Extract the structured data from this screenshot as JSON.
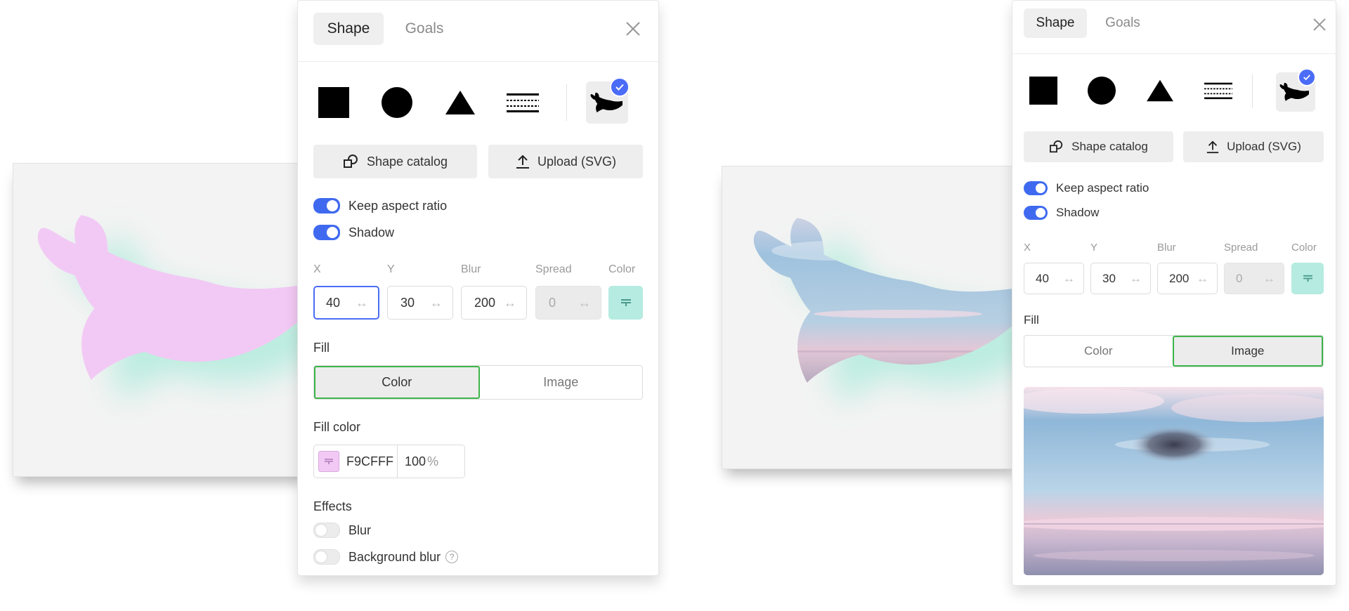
{
  "colors": {
    "accent": "#3f6af0",
    "active_segment_border": "#3cb54a",
    "shadow_color": "#b5ebe0",
    "fill_color": "#F9CFFF"
  },
  "left_panel": {
    "tabs": [
      {
        "label": "Shape",
        "active": true
      },
      {
        "label": "Goals",
        "active": false
      }
    ],
    "shapes": [
      "square-icon",
      "circle-icon",
      "triangle-icon",
      "dashed-lines-icon",
      "whale-icon"
    ],
    "selected_shape": "whale-icon",
    "buttons": {
      "catalog": "Shape catalog",
      "upload": "Upload (SVG)"
    },
    "toggles": {
      "keep_aspect": {
        "label": "Keep aspect ratio",
        "on": true
      },
      "shadow": {
        "label": "Shadow",
        "on": true
      }
    },
    "shadow_fields": {
      "x": {
        "label": "X",
        "value": "40"
      },
      "y": {
        "label": "Y",
        "value": "30"
      },
      "blur": {
        "label": "Blur",
        "value": "200"
      },
      "spread": {
        "label": "Spread",
        "value": "0"
      },
      "color": {
        "label": "Color"
      }
    },
    "fill": {
      "title": "Fill",
      "options": [
        "Color",
        "Image"
      ],
      "selected": "Color"
    },
    "fill_color": {
      "title": "Fill color",
      "hex": "F9CFFF",
      "opacity": "100",
      "unit": "%"
    },
    "effects": {
      "title": "Effects",
      "blur": {
        "label": "Blur",
        "on": false
      },
      "background_blur": {
        "label": "Background blur",
        "on": false,
        "help": "?"
      }
    }
  },
  "right_panel": {
    "tabs": [
      {
        "label": "Shape",
        "active": true
      },
      {
        "label": "Goals",
        "active": false
      }
    ],
    "shapes": [
      "square-icon",
      "circle-icon",
      "triangle-icon",
      "dashed-lines-icon",
      "whale-icon"
    ],
    "selected_shape": "whale-icon",
    "buttons": {
      "catalog": "Shape catalog",
      "upload": "Upload (SVG)"
    },
    "toggles": {
      "keep_aspect": {
        "label": "Keep aspect ratio",
        "on": true
      },
      "shadow": {
        "label": "Shadow",
        "on": true
      }
    },
    "shadow_fields": {
      "x": {
        "label": "X",
        "value": "40"
      },
      "y": {
        "label": "Y",
        "value": "30"
      },
      "blur": {
        "label": "Blur",
        "value": "200"
      },
      "spread": {
        "label": "Spread",
        "value": "0"
      },
      "color": {
        "label": "Color"
      }
    },
    "fill": {
      "title": "Fill",
      "options": [
        "Color",
        "Image"
      ],
      "selected": "Image"
    }
  }
}
